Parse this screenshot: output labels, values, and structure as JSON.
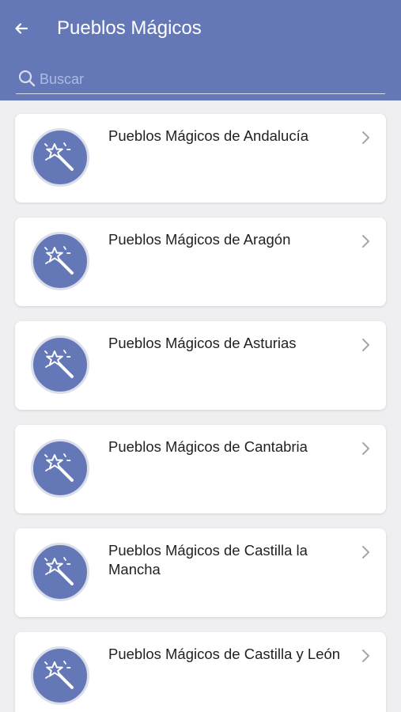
{
  "header": {
    "title": "Pueblos Mágicos",
    "back_icon": "arrow-left-icon",
    "background_color": "#6478b8"
  },
  "search": {
    "placeholder": "Buscar",
    "value": "",
    "icon": "search-icon"
  },
  "items": [
    {
      "label": "Pueblos Mágicos de Andalucía",
      "icon": "magic-wand-icon"
    },
    {
      "label": "Pueblos Mágicos de Aragón",
      "icon": "magic-wand-icon"
    },
    {
      "label": "Pueblos Mágicos de Asturias",
      "icon": "magic-wand-icon"
    },
    {
      "label": "Pueblos Mágicos de Cantabria",
      "icon": "magic-wand-icon"
    },
    {
      "label": "Pueblos Mágicos de Castilla la Mancha",
      "icon": "magic-wand-icon"
    },
    {
      "label": "Pueblos Mágicos de Castilla y León",
      "icon": "magic-wand-icon"
    }
  ]
}
